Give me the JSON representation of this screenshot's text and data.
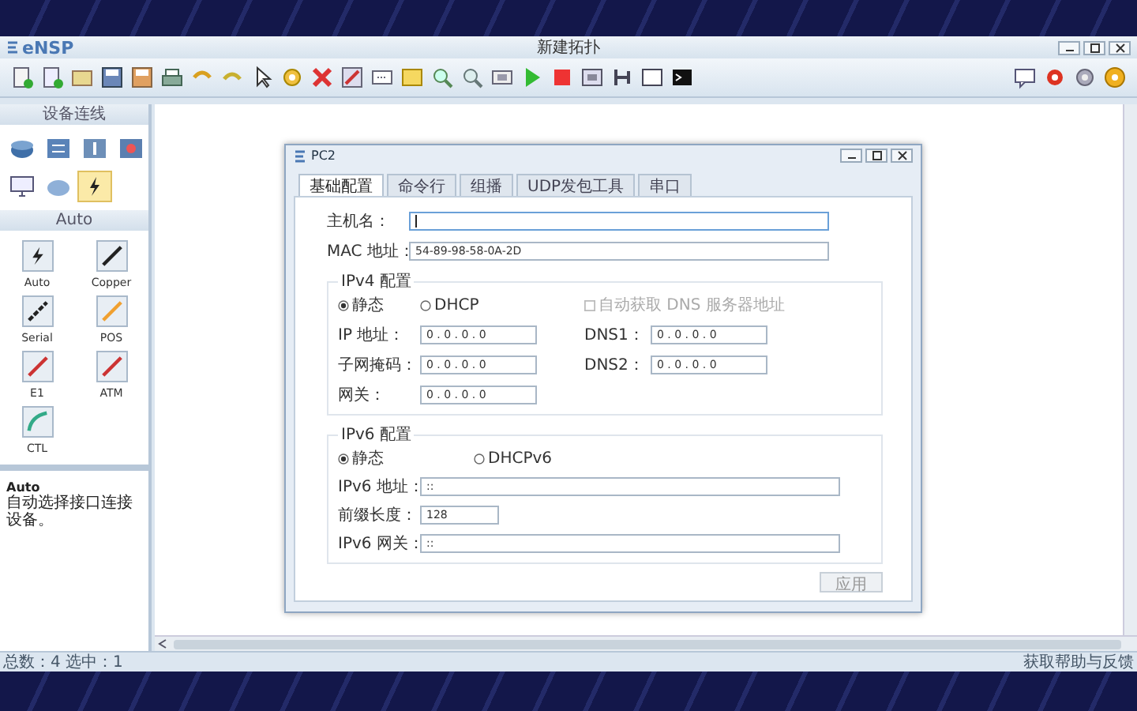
{
  "window": {
    "logo": "eNSP",
    "title": "新建拓扑"
  },
  "left_panel": {
    "devices_header": "设备连线",
    "devices": [
      {
        "kind": "router",
        "selected": false
      },
      {
        "kind": "switch",
        "selected": false
      },
      {
        "kind": "wireless",
        "selected": false
      },
      {
        "kind": "firewall",
        "selected": false
      },
      {
        "kind": "pc",
        "selected": false
      },
      {
        "kind": "cloud",
        "selected": false
      },
      {
        "kind": "link",
        "selected": true
      }
    ],
    "links_header": "Auto",
    "links": [
      {
        "kind": "auto",
        "label": "Auto"
      },
      {
        "kind": "copper",
        "label": "Copper"
      },
      {
        "kind": "serial",
        "label": "Serial"
      },
      {
        "kind": "pos",
        "label": "POS"
      },
      {
        "kind": "e1",
        "label": "E1"
      },
      {
        "kind": "atm",
        "label": "ATM"
      },
      {
        "kind": "ctl",
        "label": "CTL"
      }
    ],
    "info": {
      "title": "Auto",
      "description": "自动选择接口连接设备。"
    }
  },
  "dialog": {
    "title": "PC2",
    "tabs": [
      {
        "label": "基础配置",
        "selected": true
      },
      {
        "label": "命令行",
        "selected": false
      },
      {
        "label": "组播",
        "selected": false
      },
      {
        "label": "UDP发包工具",
        "selected": false
      },
      {
        "label": "串口",
        "selected": false
      }
    ],
    "hostname": {
      "label": "主机名：",
      "focused": true
    },
    "mac": {
      "label": "MAC 地址：",
      "value": "54-89-98-58-0A-2D"
    },
    "ipv4": {
      "title": "IPv4 配置",
      "modes": [
        {
          "label": "静态",
          "selected": true
        },
        {
          "label": "DHCP",
          "selected": false
        }
      ],
      "dns_auto": {
        "label": "自动获取 DNS 服务器地址",
        "checked": false,
        "disabled": true
      },
      "rows": [
        {
          "label": "IP 地址：",
          "value": "0 . 0 . 0 . 0",
          "dns_label": "DNS1：",
          "dns_value": "0 . 0 . 0 . 0"
        },
        {
          "label": "子网掩码：",
          "value": "0 . 0 . 0 . 0",
          "dns_label": "DNS2：",
          "dns_value": "0 . 0 . 0 . 0"
        },
        {
          "label": "网关：",
          "value": "0 . 0 . 0 . 0"
        }
      ]
    },
    "ipv6": {
      "title": "IPv6 配置",
      "modes": [
        {
          "label": "静态",
          "selected": true
        },
        {
          "label": "DHCPv6",
          "selected": false
        }
      ],
      "fields": [
        {
          "kind": "wide",
          "label": "IPv6 地址：",
          "value": "::"
        },
        {
          "kind": "short",
          "label": "前缀长度：",
          "value": "128"
        },
        {
          "kind": "wide",
          "label": "IPv6 网关：",
          "value": "::"
        }
      ]
    },
    "apply": {
      "label": "应用",
      "disabled": true
    }
  },
  "status_bar": {
    "left": "总数：4 选中：1",
    "right": "获取帮助与反馈"
  }
}
